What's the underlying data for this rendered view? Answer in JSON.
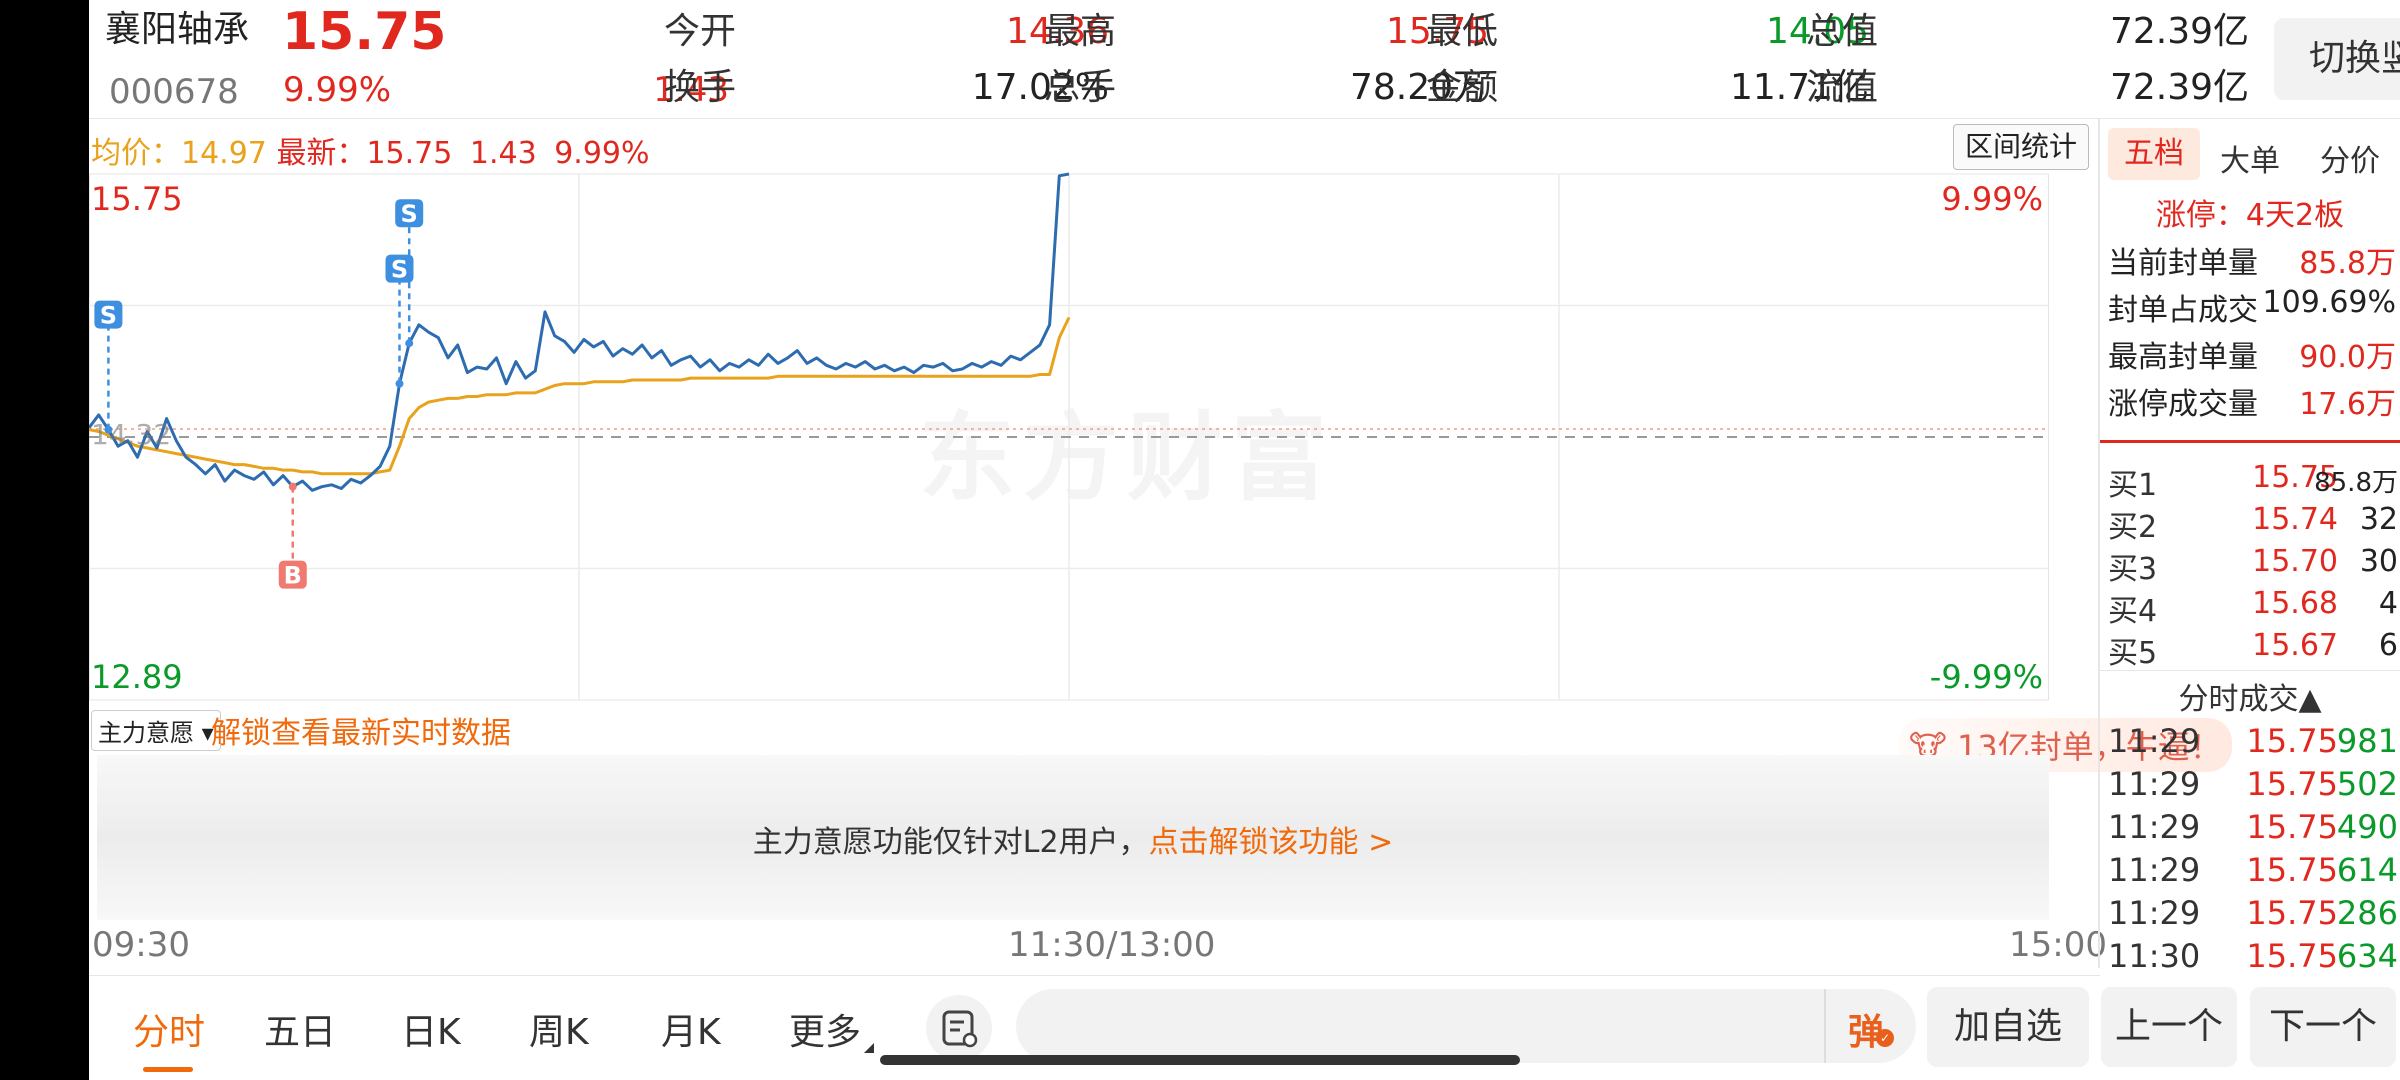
{
  "stock": {
    "name": "襄阳轴承",
    "code": "000678",
    "price": "15.75",
    "change_pct": "9.99%",
    "change": "1.43"
  },
  "quote": {
    "open_label": "今开",
    "open": "14.36",
    "high_label": "最高",
    "high": "15.75",
    "low_label": "最低",
    "low": "14.05",
    "mktcap_label": "总值",
    "mktcap": "72.39亿",
    "turnover_label": "换手",
    "turnover": "17.02%",
    "volume_label": "总手",
    "volume": "78.20万",
    "amount_label": "金额",
    "amount": "11.71亿",
    "float_label": "流值",
    "float": "72.39亿"
  },
  "switch_button": "切换竖屏",
  "chart_header": {
    "avg_label": "均价：",
    "avg": "14.97",
    "latest_label": "最新：",
    "latest": "15.75",
    "change": "1.43",
    "change_pct": "9.99%",
    "range_button": "区间统计"
  },
  "chart_data": {
    "type": "line",
    "y_top_label": "15.75",
    "y_bottom_label": "12.89",
    "y_mid_label": "14.32",
    "pct_top_label": "9.99%",
    "pct_bottom_label": "-9.99%",
    "ylim": [
      12.89,
      15.75
    ],
    "prev_close": 14.32,
    "x_labels": [
      "09:30",
      "11:30/13:00",
      "15:00"
    ],
    "series": [
      {
        "name": "",
        "color": "#2d6cb0",
        "values": [
          14.37,
          14.44,
          14.36,
          14.27,
          14.3,
          14.21,
          14.35,
          14.26,
          14.42,
          14.3,
          14.21,
          14.17,
          14.12,
          14.17,
          14.08,
          14.14,
          14.11,
          14.09,
          14.13,
          14.06,
          14.11,
          14.05,
          14.08,
          14.03,
          14.05,
          14.06,
          14.04,
          14.09,
          14.07,
          14.11,
          14.16,
          14.27,
          14.61,
          14.83,
          14.93,
          14.89,
          14.86,
          14.75,
          14.82,
          14.67,
          14.7,
          14.69,
          14.75,
          14.61,
          14.73,
          14.64,
          14.68,
          15.0,
          14.87,
          14.84,
          14.78,
          14.85,
          14.81,
          14.84,
          14.76,
          14.8,
          14.77,
          14.82,
          14.75,
          14.79,
          14.71,
          14.74,
          14.76,
          14.7,
          14.74,
          14.68,
          14.72,
          14.7,
          14.74,
          14.71,
          14.77,
          14.72,
          14.75,
          14.79,
          14.72,
          14.75,
          14.71,
          14.69,
          14.72,
          14.7,
          14.73,
          14.69,
          14.71,
          14.68,
          14.7,
          14.67,
          14.71,
          14.7,
          14.72,
          14.68,
          14.69,
          14.72,
          14.7,
          14.73,
          14.71,
          14.76,
          14.74,
          14.78,
          14.82,
          14.93,
          15.74,
          15.75
        ]
      },
      {
        "name": "均价",
        "color": "#e9a21b",
        "values": [
          14.36,
          14.35,
          14.33,
          14.31,
          14.29,
          14.27,
          14.26,
          14.25,
          14.24,
          14.23,
          14.22,
          14.21,
          14.2,
          14.19,
          14.18,
          14.17,
          14.17,
          14.16,
          14.15,
          14.15,
          14.14,
          14.14,
          14.13,
          14.13,
          14.12,
          14.12,
          14.12,
          14.12,
          14.12,
          14.12,
          14.13,
          14.14,
          14.27,
          14.42,
          14.48,
          14.51,
          14.52,
          14.53,
          14.53,
          14.54,
          14.54,
          14.55,
          14.55,
          14.55,
          14.56,
          14.56,
          14.56,
          14.58,
          14.6,
          14.61,
          14.61,
          14.61,
          14.62,
          14.62,
          14.62,
          14.62,
          14.63,
          14.63,
          14.63,
          14.63,
          14.63,
          14.63,
          14.64,
          14.64,
          14.64,
          14.64,
          14.64,
          14.64,
          14.64,
          14.64,
          14.64,
          14.65,
          14.65,
          14.65,
          14.65,
          14.65,
          14.65,
          14.65,
          14.65,
          14.65,
          14.65,
          14.65,
          14.65,
          14.65,
          14.65,
          14.65,
          14.65,
          14.65,
          14.65,
          14.65,
          14.65,
          14.65,
          14.65,
          14.65,
          14.65,
          14.65,
          14.65,
          14.65,
          14.66,
          14.66,
          14.86,
          14.97
        ]
      }
    ],
    "markers": [
      {
        "label": "S",
        "index": 2,
        "color": "#3f8fe0"
      },
      {
        "label": "S",
        "index": 32,
        "color": "#3f8fe0"
      },
      {
        "label": "S",
        "index": 33,
        "color": "#3f8fe0"
      },
      {
        "label": "B",
        "index": 21,
        "color": "#f07a6f"
      }
    ]
  },
  "watermark": "东方财富",
  "banner": "13亿封单，牛逼！",
  "main_force": {
    "select_label": "主力意愿",
    "unlock_link": "解锁查看最新实时数据",
    "notice": "主力意愿功能仅针对L2用户，",
    "notice_link": "点击解锁该功能 >"
  },
  "right_panel": {
    "tabs": [
      "五档",
      "大单",
      "分价"
    ],
    "limit_up": "涨停：4天2板",
    "stats": [
      {
        "label": "当前封单量",
        "value": "85.8万"
      },
      {
        "label": "封单占成交",
        "value": "109.69%"
      },
      {
        "label": "最高封单量",
        "value": "90.0万"
      },
      {
        "label": "涨停成交量",
        "value": "17.6万"
      }
    ],
    "bids": [
      {
        "label": "买1",
        "price": "15.75",
        "vol": "85.8万"
      },
      {
        "label": "买2",
        "price": "15.74",
        "vol": "32"
      },
      {
        "label": "买3",
        "price": "15.70",
        "vol": "30"
      },
      {
        "label": "买4",
        "price": "15.68",
        "vol": "4"
      },
      {
        "label": "买5",
        "price": "15.67",
        "vol": "6"
      }
    ],
    "trades_title": "分时成交▲",
    "trades": [
      {
        "time": "11:29",
        "price": "15.75",
        "vol": "981"
      },
      {
        "time": "11:29",
        "price": "15.75",
        "vol": "502"
      },
      {
        "time": "11:29",
        "price": "15.75",
        "vol": "490"
      },
      {
        "time": "11:29",
        "price": "15.75",
        "vol": "614"
      },
      {
        "time": "11:29",
        "price": "15.75",
        "vol": "286"
      },
      {
        "time": "11:30",
        "price": "15.75",
        "vol": "634"
      }
    ]
  },
  "bottom_tabs": [
    "分时",
    "五日",
    "日K",
    "周K",
    "月K",
    "更多"
  ],
  "bottom_buttons": {
    "danmu": "弹",
    "add_watch": "加自选",
    "prev": "上一个",
    "next": "下一个"
  }
}
